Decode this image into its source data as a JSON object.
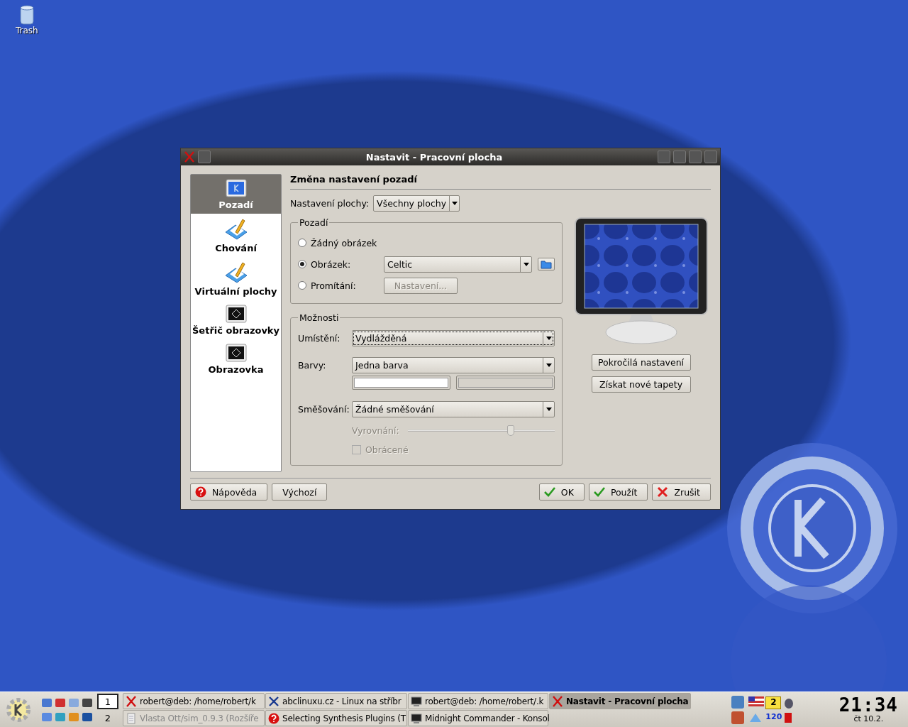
{
  "desktop_icons": [
    {
      "label": "Trash"
    }
  ],
  "window": {
    "title": "Nastavit - Pracovní plocha"
  },
  "sidebar": {
    "items": [
      {
        "label": "Pozadí",
        "selected": true,
        "kind": "monitor"
      },
      {
        "label": "Chování",
        "selected": false,
        "kind": "pencil"
      },
      {
        "label": "Virtuální plochy",
        "selected": false,
        "kind": "pencil"
      },
      {
        "label": "Šetřič obrazovky",
        "selected": false,
        "kind": "screen"
      },
      {
        "label": "Obrazovka",
        "selected": false,
        "kind": "screen"
      }
    ]
  },
  "heading": "Změna nastavení pozadí",
  "desktop_select": {
    "label": "Nastavení plochy:",
    "value": "Všechny plochy"
  },
  "background_group": {
    "title": "Pozadí",
    "options": [
      {
        "label": "Žádný obrázek",
        "selected": false,
        "kind": "plain"
      },
      {
        "label": "Obrázek:",
        "selected": true,
        "kind": "combo",
        "value": "Celtic"
      },
      {
        "label": "Promítání:",
        "selected": false,
        "kind": "button",
        "button": {
          "label": "Nastavení...",
          "disabled": true
        }
      }
    ]
  },
  "options_group": {
    "title": "Možnosti",
    "placement": {
      "label": "Umístění:",
      "value": "Vydlážděná"
    },
    "colors": {
      "label": "Barvy:",
      "value": "Jedna barva"
    },
    "blending": {
      "label": "Směšování:",
      "value": "Žádné směšování"
    },
    "balance": {
      "label": "Vyrovnání:",
      "level": 0.7,
      "disabled": true
    },
    "reverse": {
      "label": "Obrácené",
      "checked": false,
      "disabled": true
    }
  },
  "preview_buttons": [
    "Pokročilá nastavení",
    "Získat nové tapety"
  ],
  "footer": {
    "left_buttons": [
      {
        "label": "Nápověda",
        "kind": "help"
      },
      {
        "label": "Výchozí",
        "kind": "plain"
      }
    ],
    "right_buttons": [
      {
        "label": "OK",
        "kind": "ok"
      },
      {
        "label": "Použít",
        "kind": "ok"
      },
      {
        "label": "Zrušit",
        "kind": "cancel"
      }
    ]
  },
  "taskbar": {
    "pager": [
      {
        "label": "1",
        "selected": true
      },
      {
        "label": "2",
        "selected": false
      }
    ],
    "tasks": [
      {
        "label": "robert@deb: /home/robert/k",
        "selected": false,
        "minimized": false,
        "kind": "x"
      },
      {
        "label": "abclinuxu.cz - Linux na stříbr",
        "selected": false,
        "minimized": false,
        "kind": "browser"
      },
      {
        "label": "robert@deb: /home/robert/.k",
        "selected": false,
        "minimized": false,
        "kind": "terminal"
      },
      {
        "label": "Nastavit - Pracovní plocha",
        "selected": true,
        "minimized": false,
        "kind": "x"
      },
      {
        "label": "Vlasta Ott/sim_0.9.3 (Rozšíře",
        "selected": false,
        "minimized": true,
        "kind": "doc"
      },
      {
        "label": "Selecting Synthesis Plugins (T",
        "selected": false,
        "minimized": false,
        "kind": "help"
      },
      {
        "label": "Midnight Commander - Konsol",
        "selected": false,
        "minimized": false,
        "kind": "terminal"
      }
    ],
    "mail_count": "2",
    "net_count": "120",
    "clock": "21:34",
    "date": "čt 10.2."
  }
}
